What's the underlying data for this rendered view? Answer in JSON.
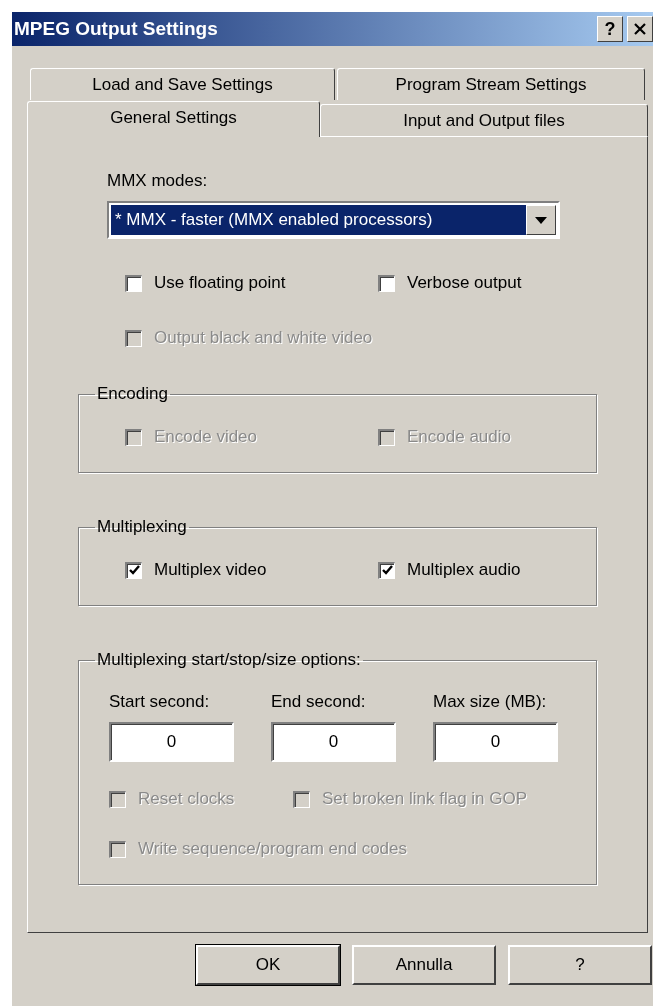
{
  "window": {
    "title": "MPEG Output Settings",
    "help_button": "?"
  },
  "tab_rows": [
    [
      {
        "label": "Load and Save Settings",
        "selected": false
      },
      {
        "label": "Program Stream Settings",
        "selected": false
      }
    ],
    [
      {
        "label": "General Settings",
        "selected": true
      },
      {
        "label": "Input and Output files",
        "selected": false
      }
    ]
  ],
  "mmx_modes": {
    "label": "MMX modes:",
    "value": "* MMX - faster (MMX enabled processors)"
  },
  "option_rows": [
    [
      {
        "label": "Use floating point",
        "checked": false,
        "disabled": false
      },
      {
        "label": "Verbose output",
        "checked": false,
        "disabled": false
      }
    ],
    [
      {
        "label": "Output black and white video",
        "checked": false,
        "disabled": true
      }
    ]
  ],
  "groups": [
    {
      "title": "Encoding",
      "kind": "checks",
      "option_rows": [
        [
          {
            "label": "Encode video",
            "checked": false,
            "disabled": true
          },
          {
            "label": "Encode audio",
            "checked": false,
            "disabled": true
          }
        ]
      ]
    },
    {
      "title": "Multiplexing",
      "kind": "checks",
      "option_rows": [
        [
          {
            "label": "Multiplex video",
            "checked": true,
            "disabled": false
          },
          {
            "label": "Multiplex audio",
            "checked": true,
            "disabled": false
          }
        ]
      ]
    },
    {
      "title": "Multiplexing start/stop/size options:",
      "kind": "fields",
      "fields": [
        {
          "label": "Start second:",
          "value": "0"
        },
        {
          "label": "End second:",
          "value": "0"
        },
        {
          "label": "Max size (MB):",
          "value": "0"
        }
      ],
      "option_rows": [
        [
          {
            "label": "Reset clocks",
            "checked": false,
            "disabled": true
          },
          {
            "label": "Set broken link flag in GOP",
            "checked": false,
            "disabled": true
          }
        ],
        [
          {
            "label": "Write sequence/program end codes",
            "checked": false,
            "disabled": true
          }
        ]
      ]
    }
  ],
  "buttons": [
    {
      "label": "OK",
      "default": true
    },
    {
      "label": "Annulla",
      "default": false
    },
    {
      "label": "?",
      "default": false
    }
  ]
}
